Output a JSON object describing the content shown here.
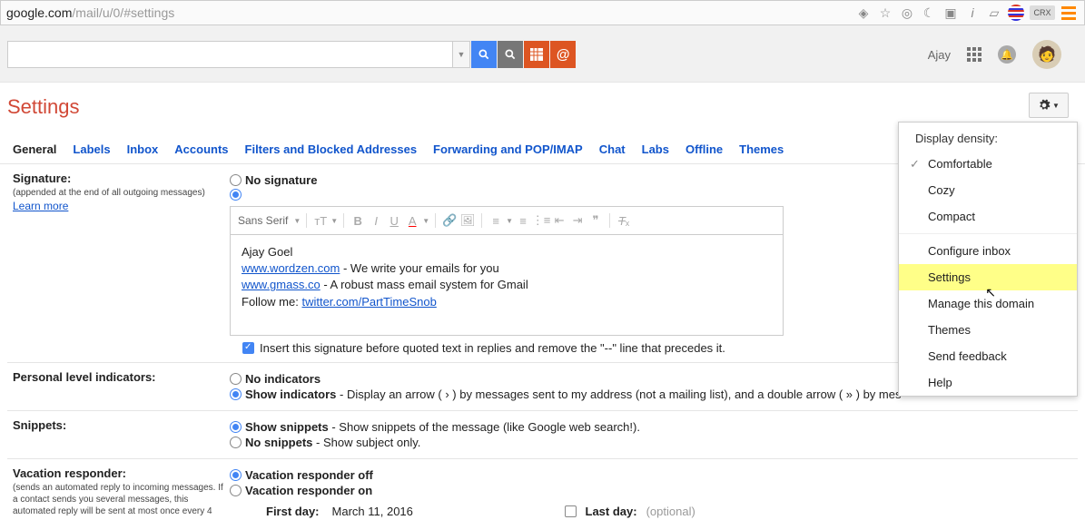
{
  "url": {
    "host": "google.com",
    "path": "/mail/u/0/#settings"
  },
  "header": {
    "user_name": "Ajay"
  },
  "page_title": "Settings",
  "tabs": [
    "General",
    "Labels",
    "Inbox",
    "Accounts",
    "Filters and Blocked Addresses",
    "Forwarding and POP/IMAP",
    "Chat",
    "Labs",
    "Offline",
    "Themes"
  ],
  "active_tab": "General",
  "signature": {
    "label": "Signature:",
    "sub": "(appended at the end of all outgoing messages)",
    "learn": "Learn more",
    "no_sig": "No signature",
    "insert_text": "Insert this signature before quoted text in replies and remove the \"--\" line that precedes it.",
    "font_name": "Sans Serif",
    "body": {
      "name": "Ajay Goel",
      "link1": "www.wordzen.com",
      "desc1": " - We write your emails for you",
      "link2": "www.gmass.co",
      "desc2": " - A robust mass email system for Gmail",
      "follow": "Follow me: ",
      "link3": "twitter.com/PartTimeSnob"
    }
  },
  "personal": {
    "label": "Personal level indicators:",
    "no_ind": "No indicators",
    "show_title": "Show indicators",
    "show_desc": " - Display an arrow ( › ) by messages sent to my address (not a mailing list), and a double arrow ( » ) by mes"
  },
  "snippets": {
    "label": "Snippets:",
    "show_title": "Show snippets",
    "show_desc": " - Show snippets of the message (like Google web search!).",
    "no_title": "No snippets",
    "no_desc": " - Show subject only."
  },
  "vacation": {
    "label": "Vacation responder:",
    "sub": "(sends an automated reply to incoming messages. If a contact sends you several messages, this automated reply will be sent at most once every 4",
    "off": "Vacation responder off",
    "on": "Vacation responder on",
    "first_day_label": "First day:",
    "first_day_value": "March 11, 2016",
    "last_day_label": "Last day:",
    "last_day_placeholder": "(optional)"
  },
  "gear_menu": {
    "density_header": "Display density:",
    "items1": [
      "Comfortable",
      "Cozy",
      "Compact"
    ],
    "items2": [
      "Configure inbox",
      "Settings",
      "Manage this domain",
      "Themes",
      "Send feedback",
      "Help"
    ],
    "highlighted": "Settings",
    "checked": "Comfortable"
  },
  "ext_labels": {
    "crx": "CRX"
  }
}
